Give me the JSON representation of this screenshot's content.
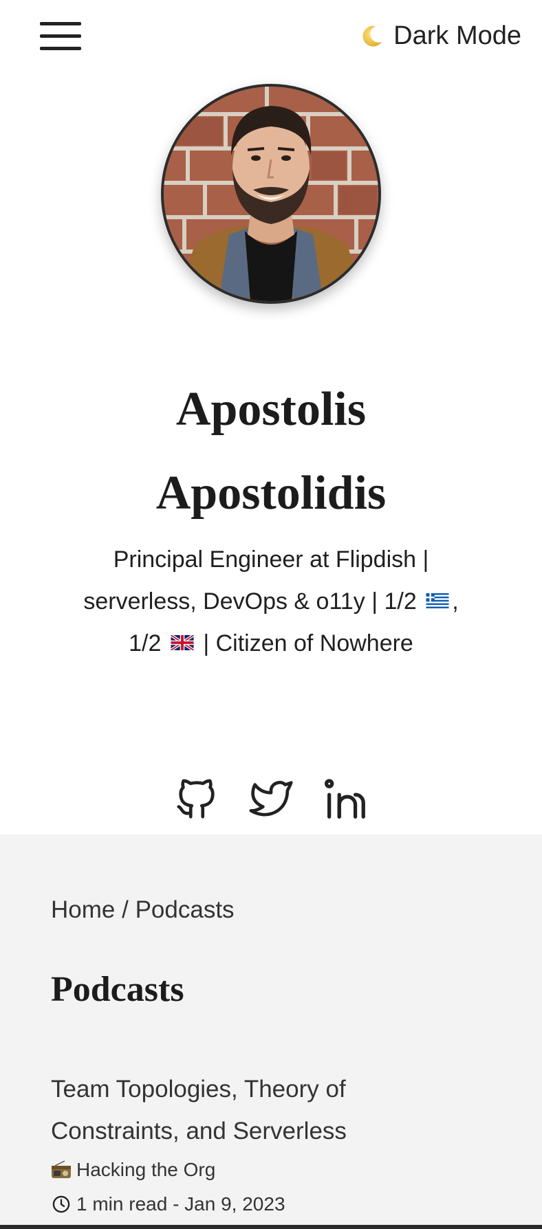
{
  "header": {
    "menu_icon": "hamburger-menu-icon",
    "theme_toggle_icon": "crescent-moon-icon",
    "theme_toggle_label": "Dark Mode"
  },
  "profile": {
    "name_line1": "Apostolis",
    "name_line2": "Apostolidis",
    "bio_line1": "Principal Engineer at Flipdish |",
    "bio_line2a": "serverless, DevOps & o11y | 1/2",
    "bio_line2b": ",",
    "bio_line3a": "1/2",
    "bio_line3b": "| Citizen of Nowhere",
    "flags": [
      "greece-flag-icon",
      "uk-flag-icon"
    ],
    "socials": [
      "github-icon",
      "twitter-icon",
      "linkedin-icon"
    ]
  },
  "breadcrumb": {
    "home": "Home",
    "separator": "/",
    "current": "Podcasts"
  },
  "page_title": "Podcasts",
  "posts": [
    {
      "title_line1": "Team Topologies, Theory of",
      "title_line2": "Constraints, and Serverless",
      "show_icon": "radio-icon",
      "show": "Hacking the Org",
      "meta_icon": "clock-icon",
      "meta": "1 min read - Jan 9, 2023"
    }
  ],
  "colors": {
    "text": "#1f1f1f",
    "content_bg": "#f3f3f3",
    "page_bg": "#ffffff"
  }
}
